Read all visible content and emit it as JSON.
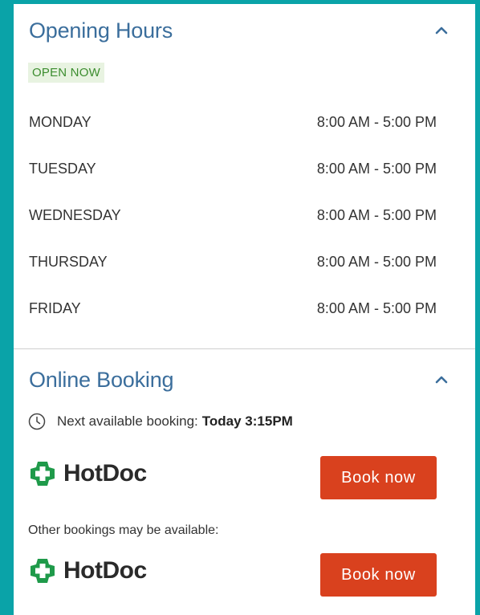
{
  "opening_hours": {
    "title": "Opening Hours",
    "status_badge": "OPEN NOW",
    "rows": [
      {
        "day": "MONDAY",
        "hours": "8:00 AM - 5:00 PM"
      },
      {
        "day": "TUESDAY",
        "hours": "8:00 AM - 5:00 PM"
      },
      {
        "day": "WEDNESDAY",
        "hours": "8:00 AM - 5:00 PM"
      },
      {
        "day": "THURSDAY",
        "hours": "8:00 AM - 5:00 PM"
      },
      {
        "day": "FRIDAY",
        "hours": "8:00 AM - 5:00 PM"
      }
    ],
    "toggle_icon": "chevron-up-icon"
  },
  "online_booking": {
    "title": "Online Booking",
    "toggle_icon": "chevron-up-icon",
    "next_label": "Next available booking:",
    "next_value": "Today 3:15PM",
    "clock_icon": "clock-icon",
    "other_note": "Other bookings may be available:",
    "providers": [
      {
        "name": "HotDoc",
        "button_label": "Book now"
      },
      {
        "name": "HotDoc",
        "button_label": "Book now"
      }
    ]
  },
  "colors": {
    "frame": "#0aa3a8",
    "heading": "#3b6e9c",
    "badge_bg": "#e8f3e1",
    "badge_text": "#3c8d2f",
    "button": "#d9411e",
    "hotdoc_green": "#1f9a4a"
  }
}
